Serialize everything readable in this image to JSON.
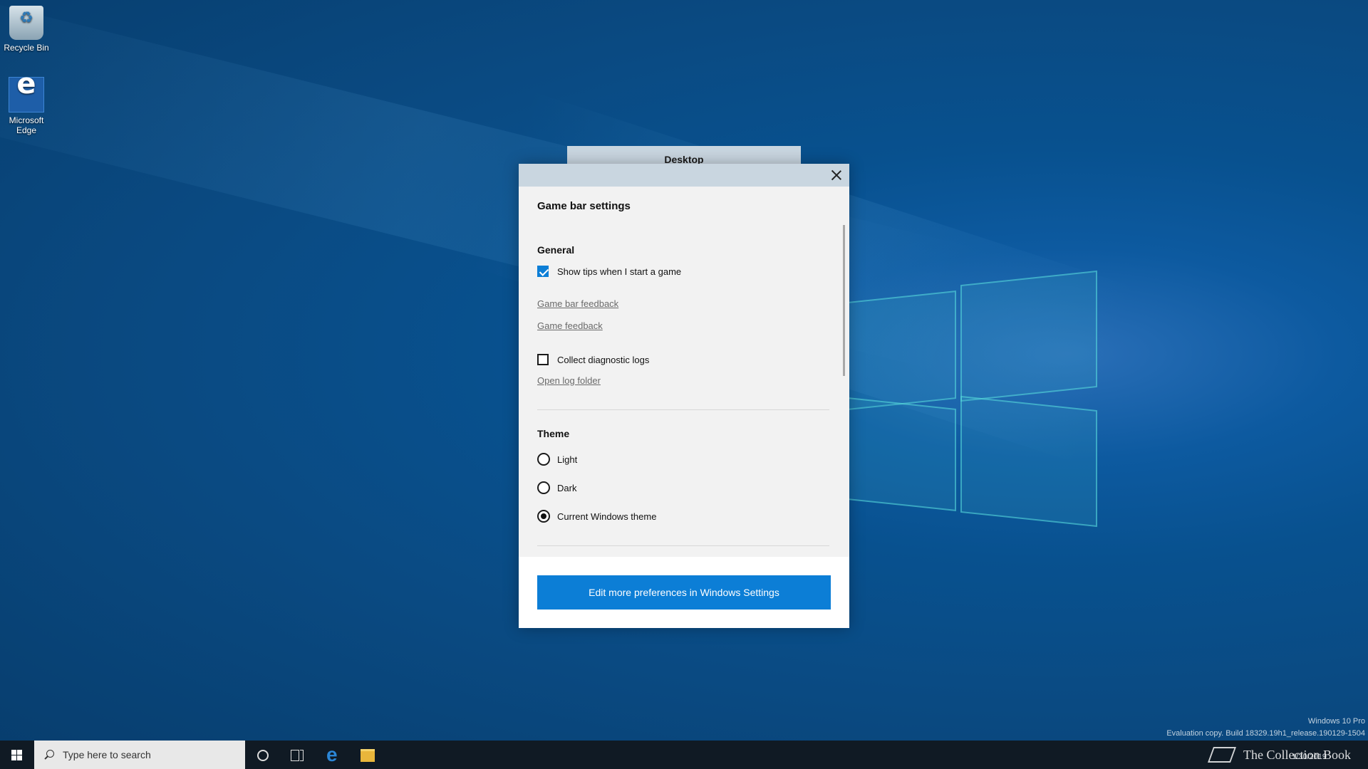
{
  "desktop": {
    "icons": [
      {
        "label": "Recycle Bin"
      },
      {
        "label": "Microsoft Edge"
      }
    ]
  },
  "dialog": {
    "tab_label": "Desktop",
    "title": "Game bar settings",
    "sections": {
      "general": {
        "heading": "General",
        "show_tips_label": "Show tips when I start a game",
        "show_tips_checked": true,
        "game_bar_feedback": "Game bar feedback",
        "game_feedback": "Game feedback",
        "collect_logs_label": "Collect diagnostic logs",
        "collect_logs_checked": false,
        "open_log_folder": "Open log folder"
      },
      "theme": {
        "heading": "Theme",
        "options": [
          "Light",
          "Dark",
          "Current Windows theme"
        ],
        "selected": "Current Windows theme"
      }
    },
    "footer_button": "Edit more preferences in Windows Settings"
  },
  "taskbar": {
    "search_placeholder": "Type here to search",
    "date": "1/30/2019"
  },
  "watermark": {
    "line1": "Windows 10 Pro",
    "line2": "Evaluation copy. Build 18329.19h1_release.190129-1504"
  },
  "overlay": {
    "brand": "The Collection Book"
  },
  "colors": {
    "accent": "#0c7ed6",
    "dialog_bg": "#f2f2f2",
    "header_bg": "#c9d6e0",
    "taskbar_bg": "#101a24"
  }
}
